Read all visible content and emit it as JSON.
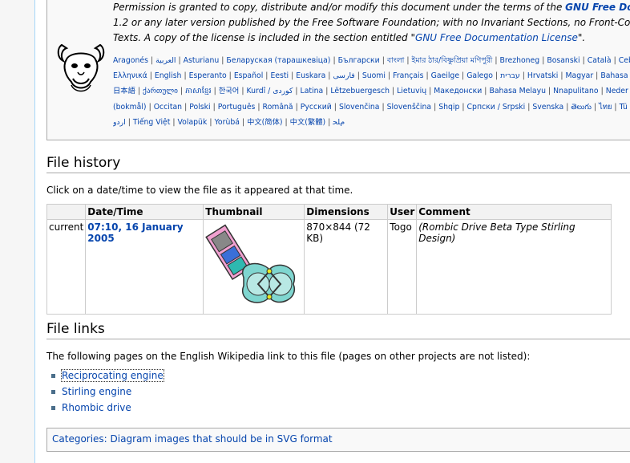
{
  "license": {
    "line1_prefix": "Permission is granted to copy, distribute and/or modify this document under the terms of the ",
    "line1_link": "GNU Free Docume",
    "line2": "1.2 or any later version published by the Free Software Foundation; with no Invariant Sections, no Front-Cover T",
    "line3_prefix": "Texts. A copy of the license is included in the section entitled \"",
    "line3_link": "GNU Free Documentation License",
    "line3_suffix": "\"."
  },
  "language_rows": [
    [
      "Aragonés",
      "العربية",
      "Asturianu",
      "Беларуская (тарашкевіца)",
      "Български",
      "বাংলা",
      "ইমার ঠার/বিষ্ণুপ্রিয়া মণিপুরী",
      "Brezhoneg",
      "Bosanski",
      "Català",
      "Ceb"
    ],
    [
      "Ελληνικά",
      "English",
      "Esperanto",
      "Español",
      "Eesti",
      "Euskara",
      "فارسی",
      "Suomi",
      "Français",
      "Gaeilge",
      "Galego",
      "עברית",
      "Hrvatski",
      "Magyar",
      "Bahasa In"
    ],
    [
      "日本語",
      "ქართული",
      "ភាសាខ្មែរ",
      "한국어",
      "Kurdî / كوردی",
      "Latina",
      "Lëtzebuergesch",
      "Lietuvių",
      "Македонски",
      "Bahasa Melayu",
      "Nnapulitano",
      "Neder"
    ],
    [
      "(bokmål)",
      "Occitan",
      "Polski",
      "Português",
      "Română",
      "Русский",
      "Slovenčina",
      "Slovenščina",
      "Shqip",
      "Српски / Srpski",
      "Svenska",
      "తెలుగు",
      "ไทย",
      "Tü"
    ],
    [
      "اردو",
      "Tiếng Việt",
      "Volapük",
      "Yorùbá",
      "中文(简体)",
      "中文(繁體)",
      "ﻡﻠﺤ"
    ]
  ],
  "file_history": {
    "heading": "File history",
    "intro": "Click on a date/time to view the file as it appeared at that time.",
    "columns": [
      "",
      "Date/Time",
      "Thumbnail",
      "Dimensions",
      "User",
      "Comment"
    ],
    "rows": [
      {
        "status": "current",
        "datetime": "07:10, 16 January 2005",
        "dimensions": "870×844 (72 KB)",
        "user": "Togo",
        "comment": "(Rombic Drive Beta Type Stirling Design)"
      }
    ]
  },
  "file_links": {
    "heading": "File links",
    "intro": "The following pages on the English Wikipedia link to this file (pages on other projects are not listed):",
    "items": [
      "Reciprocating engine",
      "Stirling engine",
      "Rhombic drive"
    ]
  },
  "categories": {
    "text": "Categories: Diagram images that should be in SVG format"
  }
}
